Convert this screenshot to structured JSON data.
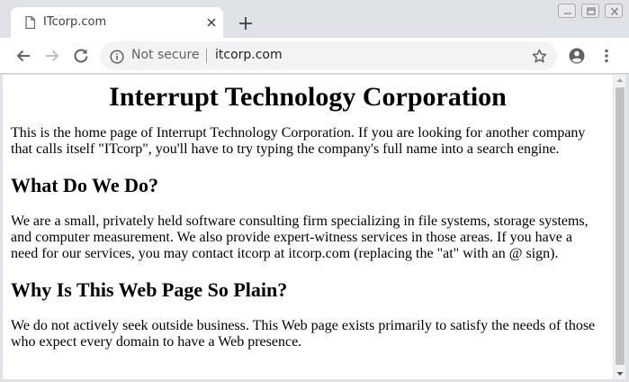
{
  "browser": {
    "tab": {
      "title": "ITcorp.com",
      "favicon_icon": "page-icon",
      "close_icon": "close-icon"
    },
    "new_tab_icon": "plus-icon",
    "window_controls": [
      "minimize-icon",
      "restore-icon",
      "close-icon"
    ],
    "toolbar": {
      "back_icon": "arrow-left-icon",
      "forward_icon": "arrow-right-icon",
      "reload_icon": "reload-icon",
      "address": {
        "info_icon": "info-icon",
        "security_label": "Not secure",
        "url": "itcorp.com",
        "star_icon": "star-icon"
      },
      "profile_icon": "account-icon",
      "menu_icon": "more-vert-icon"
    }
  },
  "page": {
    "heading": "Interrupt Technology Corporation",
    "intro": "This is the home page of Interrupt Technology Corporation. If you are looking for another company that calls itself \"ITcorp\", you'll have to try typing the company's full name into a search engine.",
    "sections": [
      {
        "heading": "What Do We Do?",
        "body": "We are a small, privately held software consulting firm specializing in file systems, storage systems, and computer measurement. We also provide expert-witness services in those areas. If you have a need for our services, you may contact itcorp at itcorp.com (replacing the \"at\" with an @ sign)."
      },
      {
        "heading": "Why Is This Web Page So Plain?",
        "body": "We do not actively seek outside business. This Web page exists primarily to satisfy the needs of those who expect every domain to have a Web presence."
      }
    ]
  },
  "colors": {
    "chrome_frame": "#dee1e6",
    "omnibox_bg": "#f1f3f4",
    "icon_gray": "#5f6368",
    "scrollbar_thumb": "#c1c1c1"
  }
}
